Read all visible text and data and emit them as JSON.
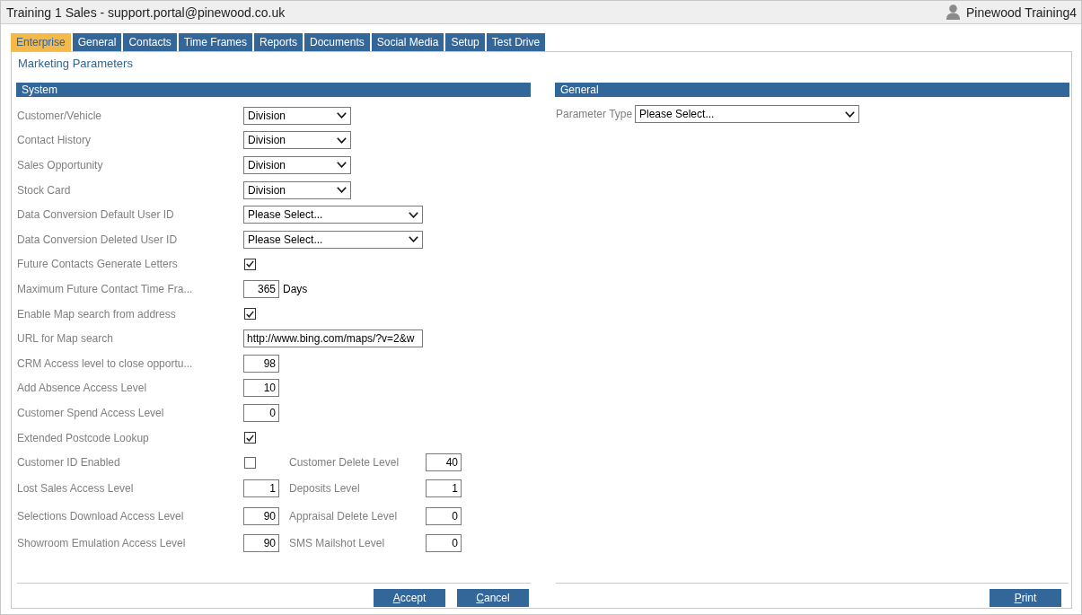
{
  "window": {
    "title": "Training 1 Sales - support.portal@pinewood.co.uk",
    "user": "Pinewood Training4"
  },
  "tabs": [
    {
      "label": "Enterprise",
      "selected": true
    },
    {
      "label": "General",
      "selected": false
    },
    {
      "label": "Contacts",
      "selected": false
    },
    {
      "label": "Time Frames",
      "selected": false
    },
    {
      "label": "Reports",
      "selected": false
    },
    {
      "label": "Documents",
      "selected": false
    },
    {
      "label": "Social Media",
      "selected": false
    },
    {
      "label": "Setup",
      "selected": false
    },
    {
      "label": "Test Drive",
      "selected": false
    }
  ],
  "page_title": "Marketing Parameters",
  "system": {
    "heading": "System",
    "rows": [
      {
        "kind": "select",
        "label": "Customer/Vehicle",
        "value": "Division"
      },
      {
        "kind": "select",
        "label": "Contact History",
        "value": "Division"
      },
      {
        "kind": "select",
        "label": "Sales Opportunity",
        "value": "Division"
      },
      {
        "kind": "select",
        "label": "Stock Card",
        "value": "Division"
      },
      {
        "kind": "select",
        "label": "Data Conversion Default User ID",
        "value": "Please Select..."
      },
      {
        "kind": "select",
        "label": "Data Conversion Deleted User ID",
        "value": "Please Select..."
      },
      {
        "kind": "checkbox",
        "label": "Future Contacts Generate Letters",
        "checked": true
      },
      {
        "kind": "number",
        "label": "Maximum Future Contact Time Fra...",
        "value": "365",
        "unit": "Days"
      },
      {
        "kind": "checkbox",
        "label": "Enable Map search from address",
        "checked": true
      },
      {
        "kind": "text",
        "label": "URL for Map search",
        "value": "http://www.bing.com/maps/?v=2&w"
      },
      {
        "kind": "number",
        "label": "CRM Access level to close opportu...",
        "value": "98"
      },
      {
        "kind": "number",
        "label": "Add Absence Access Level",
        "value": "10"
      },
      {
        "kind": "number",
        "label": "Customer Spend Access Level",
        "value": "0"
      },
      {
        "kind": "checkbox",
        "label": "Extended Postcode Lookup",
        "checked": true
      },
      {
        "kind": "checkbox",
        "label": "Customer ID Enabled",
        "checked": false,
        "paired": {
          "label": "Customer Delete Level",
          "value": "40"
        }
      },
      {
        "kind": "number",
        "label": "Lost Sales Access Level",
        "value": "1",
        "paired": {
          "label": "Deposits Level",
          "value": "1"
        }
      },
      {
        "kind": "number",
        "label": "Selections Download Access Level",
        "value": "90",
        "paired": {
          "label": "Appraisal Delete Level",
          "value": "0"
        }
      },
      {
        "kind": "number",
        "label": "Showroom Emulation Access Level",
        "value": "90",
        "paired": {
          "label": "SMS Mailshot Level",
          "value": "0"
        }
      }
    ],
    "buttons": [
      {
        "label": "Accept"
      },
      {
        "label": "Cancel"
      }
    ]
  },
  "general": {
    "heading": "General",
    "parameter_type": {
      "label": "Parameter Type",
      "value": "Please Select..."
    },
    "buttons": [
      {
        "label": "Print"
      }
    ]
  }
}
